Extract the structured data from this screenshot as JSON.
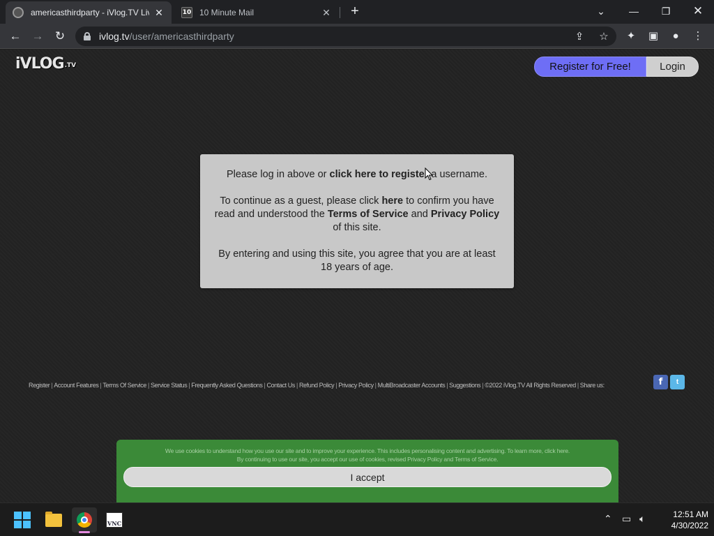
{
  "browser": {
    "tabs": [
      {
        "title": "americasthirdparty - iVlog.TV Live",
        "active": true
      },
      {
        "title": "10 Minute Mail",
        "favicon_text": "10",
        "active": false
      }
    ],
    "url_host": "ivlog.tv",
    "url_path": "/user/americasthirdparty"
  },
  "site": {
    "logo": "iVLOG",
    "logo_suffix": ".TV",
    "register_label": "Register for Free!",
    "login_label": "Login"
  },
  "notice": {
    "p1_a": "Please log in above or ",
    "p1_link": "click here to register",
    "p1_b": " a username.",
    "p2_a": "To continue as a guest, please click ",
    "p2_link": "here",
    "p2_b": " to confirm you have read and understood the ",
    "p2_tos": "Terms of Service",
    "p2_and": " and ",
    "p2_privacy": "Privacy Policy",
    "p2_c": " of this site.",
    "p3": "By entering and using this site, you agree that you are at least 18 years of age."
  },
  "footer": {
    "links": [
      "Register",
      "Account Features",
      "Terms Of Service",
      "Service Status",
      "Frequently Asked Questions",
      "Contact Us",
      "Refund Policy",
      "Privacy Policy",
      "MultiBroadcaster Accounts",
      "Suggestions"
    ],
    "copyright": "©2022 iVlog.TV All Rights Reserved",
    "share_label": "Share us:"
  },
  "cookie": {
    "line1": "We use cookies to understand how you use our site and to improve your experience. This includes personalising content and advertising. To learn more, click here.",
    "line2": "By continuing to use our site, you accept our use of cookies, revised Privacy Policy and Terms of Service.",
    "accept_label": "I accept"
  },
  "taskbar": {
    "time": "12:51 AM",
    "date": "4/30/2022"
  },
  "colors": {
    "register_bg": "#6e6ef5",
    "cookie_bg": "#3b8a38",
    "notice_bg": "#c8c8c8"
  }
}
